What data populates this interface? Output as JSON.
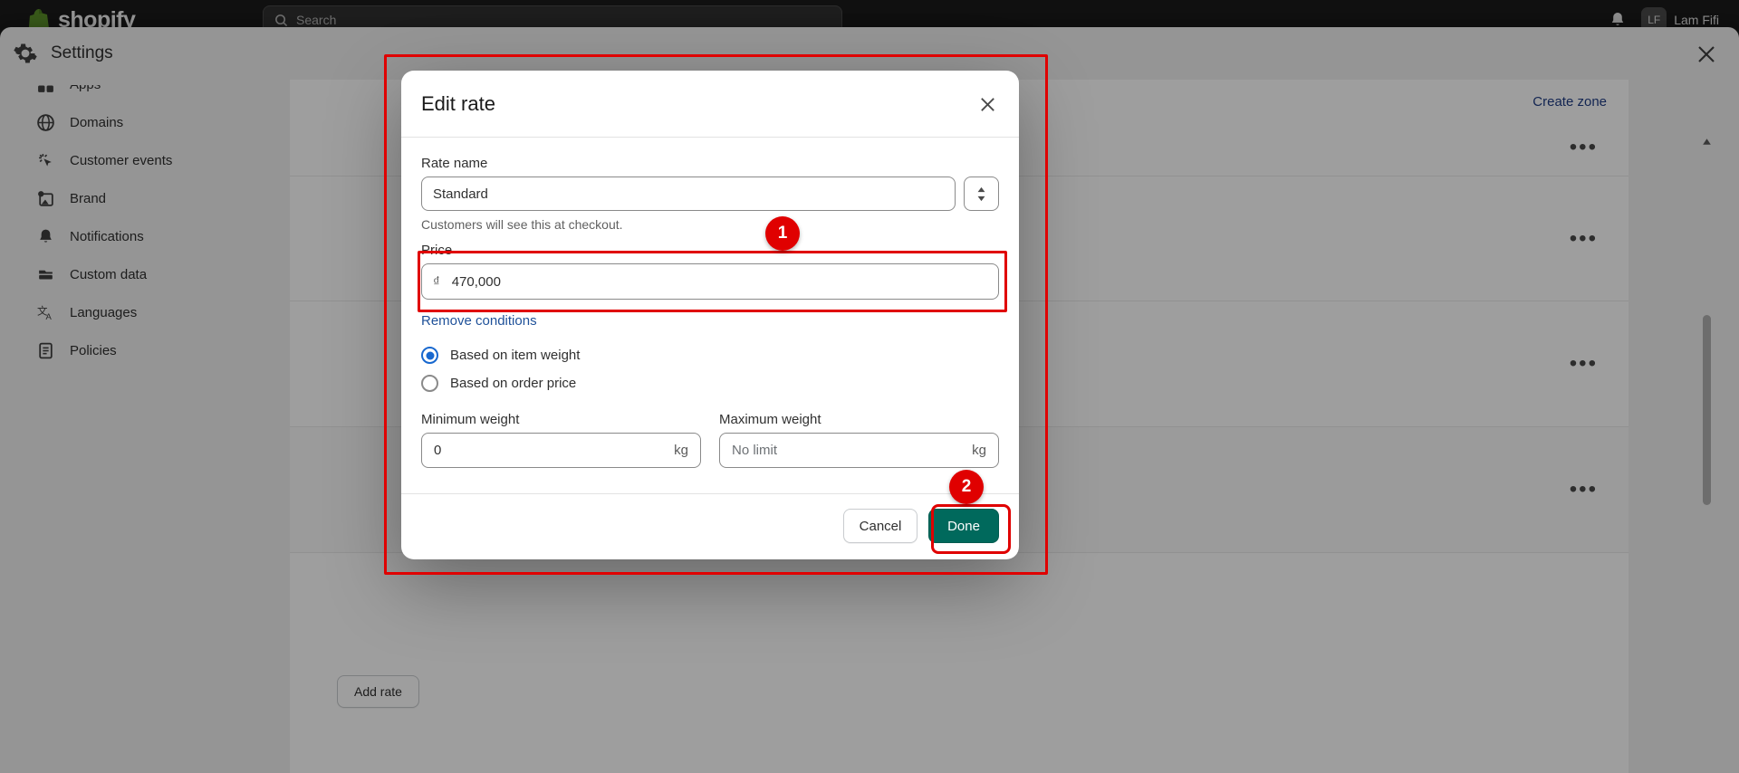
{
  "admin": {
    "brand_name": "shopify",
    "search_placeholder": "Search",
    "user_initials": "LF",
    "user_name": "Lam Fifi"
  },
  "settings": {
    "title": "Settings",
    "close_label": "×",
    "nav_items": [
      {
        "label": "Apps",
        "icon": "apps-icon"
      },
      {
        "label": "Domains",
        "icon": "globe-icon"
      },
      {
        "label": "Customer events",
        "icon": "cursor-click-icon"
      },
      {
        "label": "Brand",
        "icon": "image-icon"
      },
      {
        "label": "Notifications",
        "icon": "bell-icon"
      },
      {
        "label": "Custom data",
        "icon": "database-icon"
      },
      {
        "label": "Languages",
        "icon": "translate-icon"
      },
      {
        "label": "Policies",
        "icon": "document-icon"
      }
    ],
    "create_zone_label": "Create zone",
    "add_rate_label": "Add rate",
    "row_menu_label": "•••"
  },
  "modal": {
    "title": "Edit rate",
    "close_icon": "close-icon",
    "rate_name": {
      "label": "Rate name",
      "value": "Standard",
      "help": "Customers will see this at checkout."
    },
    "price": {
      "label": "Price",
      "currency_symbol": "₫",
      "value": "470,000"
    },
    "remove_conditions_label": "Remove conditions",
    "conditions": [
      {
        "label": "Based on item weight",
        "selected": true
      },
      {
        "label": "Based on order price",
        "selected": false
      }
    ],
    "minimum_weight": {
      "label": "Minimum weight",
      "value": "0",
      "unit": "kg"
    },
    "maximum_weight": {
      "label": "Maximum weight",
      "placeholder": "No limit",
      "unit": "kg"
    },
    "cancel_label": "Cancel",
    "done_label": "Done"
  },
  "annotations": {
    "step_one": "1",
    "step_two": "2"
  },
  "colors": {
    "annotation_red": "#e00000",
    "primary_green": "#00695c",
    "radio_blue": "#1868cf",
    "link_blue": "#1f5199"
  }
}
